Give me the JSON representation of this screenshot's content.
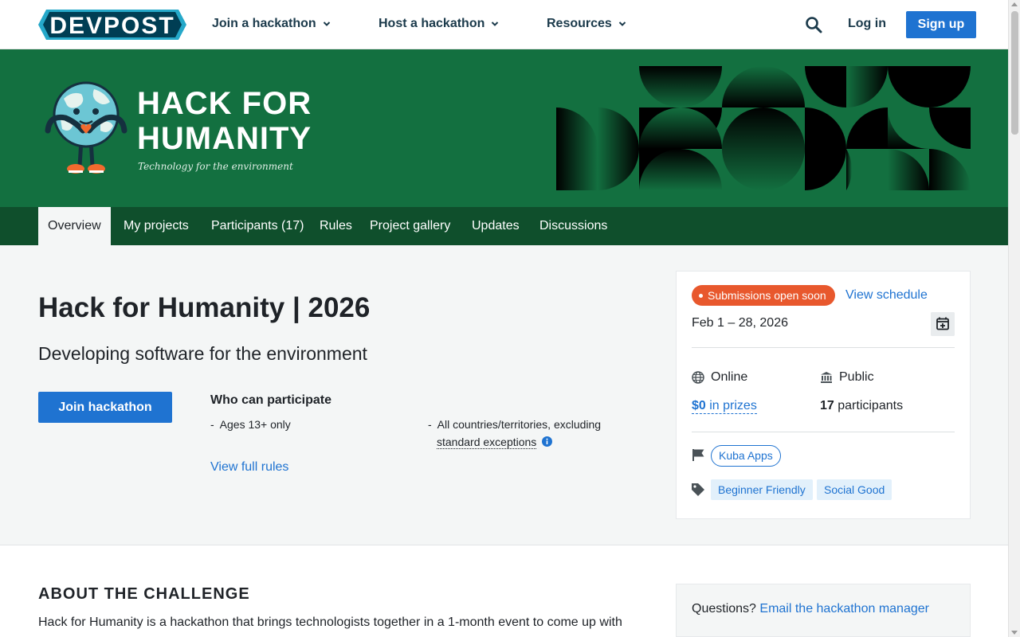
{
  "brand": {
    "logo_text": "DEVPOST",
    "primary_color": "#1f73d1",
    "banner_color": "#137040",
    "tabbar_color": "#0f4f2c",
    "status_color": "#e8582d"
  },
  "nav": {
    "items": [
      {
        "label": "Join a hackathon",
        "icon": "chevron-down-icon"
      },
      {
        "label": "Host a hackathon",
        "icon": "chevron-down-icon"
      },
      {
        "label": "Resources",
        "icon": "chevron-down-icon"
      }
    ],
    "search_icon": "search-icon",
    "login": "Log in",
    "signup": "Sign up"
  },
  "banner": {
    "title_line1": "HACK FOR",
    "title_line2": "HUMANITY",
    "subtitle": "Technology for the environment"
  },
  "tabs": [
    {
      "label": "Overview",
      "active": true
    },
    {
      "label": "My projects"
    },
    {
      "label": "Participants (17)"
    },
    {
      "label": "Rules"
    },
    {
      "label": "Project gallery"
    },
    {
      "label": "Updates"
    },
    {
      "label": "Discussions"
    }
  ],
  "hero": {
    "title": "Hack for Humanity | 2026",
    "tagline": "Developing software for the environment",
    "join_button": "Join hackathon",
    "who_title": "Who can participate",
    "eligibility": [
      "Ages 13+ only",
      "All countries/territories, excluding"
    ],
    "exceptions_link": "standard exceptions",
    "rules_link": "View full rules"
  },
  "sidebar": {
    "status": "Submissions open soon",
    "schedule_link": "View schedule",
    "dates": "Feb 1 – 28, 2026",
    "location": "Online",
    "visibility": "Public",
    "prize_amount": "$0",
    "prize_suffix": "in prizes",
    "participants_count": "17",
    "participants_suffix": "participants",
    "host": "Kuba Apps",
    "tags": [
      "Beginner Friendly",
      "Social Good"
    ]
  },
  "about": {
    "heading": "ABOUT THE CHALLENGE",
    "body": "Hack for Humanity is a hackathon that brings technologists together in a 1-month event to come up with"
  },
  "questions": {
    "label": "Questions?",
    "link": "Email the hackathon manager"
  }
}
